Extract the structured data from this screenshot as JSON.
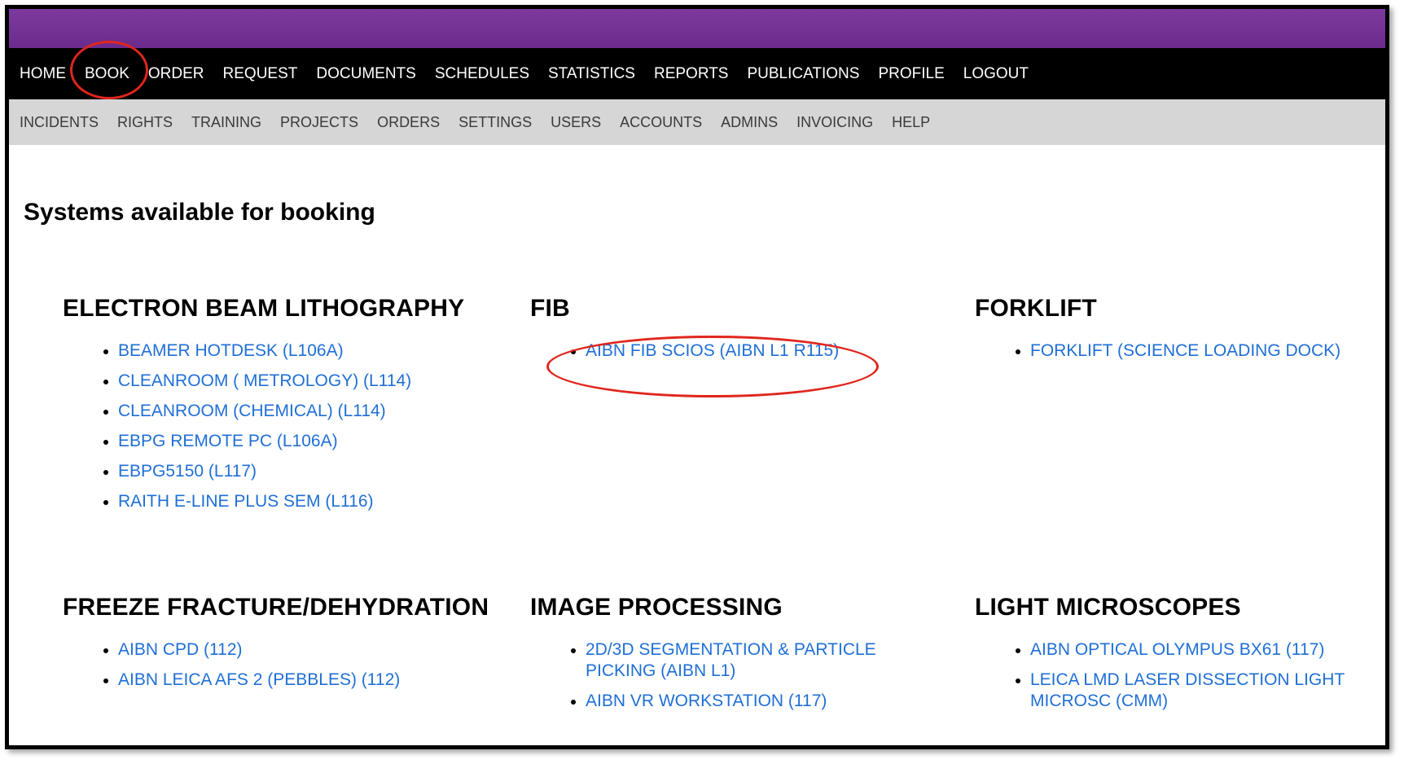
{
  "main_nav": [
    {
      "label": "HOME"
    },
    {
      "label": "BOOK"
    },
    {
      "label": "ORDER"
    },
    {
      "label": "REQUEST"
    },
    {
      "label": "DOCUMENTS"
    },
    {
      "label": "SCHEDULES"
    },
    {
      "label": "STATISTICS"
    },
    {
      "label": "REPORTS"
    },
    {
      "label": "PUBLICATIONS"
    },
    {
      "label": "PROFILE"
    },
    {
      "label": "LOGOUT"
    }
  ],
  "sub_nav": [
    {
      "label": "INCIDENTS"
    },
    {
      "label": "RIGHTS"
    },
    {
      "label": "TRAINING"
    },
    {
      "label": "PROJECTS"
    },
    {
      "label": "ORDERS"
    },
    {
      "label": "SETTINGS"
    },
    {
      "label": "USERS"
    },
    {
      "label": "ACCOUNTS"
    },
    {
      "label": "ADMINS"
    },
    {
      "label": "INVOICING"
    },
    {
      "label": "HELP"
    }
  ],
  "page_title": "Systems available for booking",
  "categories": [
    {
      "title": "ELECTRON BEAM LITHOGRAPHY",
      "items": [
        "BEAMER HOTDESK (L106A)",
        "CLEANROOM ( METROLOGY) (L114)",
        "CLEANROOM (CHEMICAL) (L114)",
        "EBPG REMOTE PC (L106A)",
        "EBPG5150 (L117)",
        "RAITH E-LINE PLUS SEM (L116)"
      ]
    },
    {
      "title": "FIB",
      "items": [
        "AIBN FIB SCIOS (AIBN L1 R115)"
      ]
    },
    {
      "title": "FORKLIFT",
      "items": [
        "FORKLIFT (SCIENCE LOADING DOCK)"
      ]
    },
    {
      "title": "FREEZE FRACTURE/DEHYDRATION",
      "items": [
        "AIBN CPD (112)",
        "AIBN LEICA AFS 2 (PEBBLES) (112)"
      ]
    },
    {
      "title": "IMAGE PROCESSING",
      "items": [
        "2D/3D SEGMENTATION & PARTICLE PICKING (AIBN L1)",
        "AIBN VR WORKSTATION (117)"
      ]
    },
    {
      "title": "LIGHT MICROSCOPES",
      "items": [
        "AIBN OPTICAL OLYMPUS BX61 (117)",
        "LEICA LMD LASER DISSECTION LIGHT MICROSC (CMM)"
      ]
    }
  ],
  "colors": {
    "header_purple": "#7d3a9e",
    "nav_black": "#000000",
    "subnav_gray": "#d6d6d6",
    "link_blue": "#1f6fd6",
    "annotation_red": "#e0261d"
  }
}
